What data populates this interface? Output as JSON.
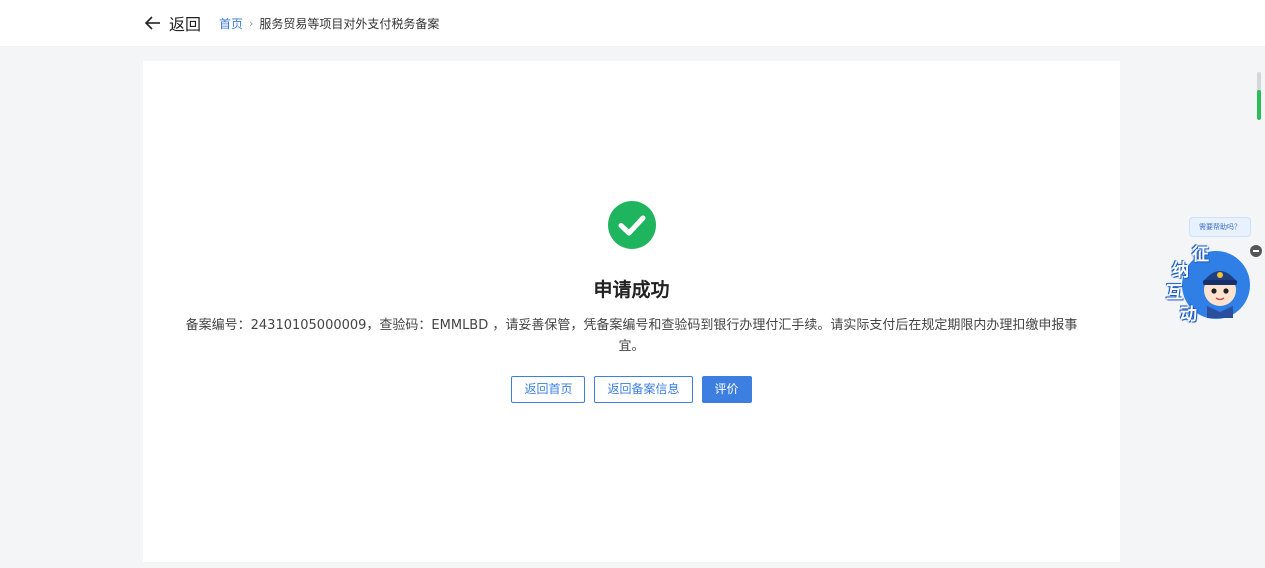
{
  "header": {
    "back_label": "返回",
    "breadcrumb": {
      "home": "首页",
      "separator": "›",
      "current": "服务贸易等项目对外支付税务备案"
    }
  },
  "result": {
    "icon": "check-circle-icon",
    "title": "申请成功",
    "message": "备案编号：24310105000009，查验码：EMMLBD ，请妥善保管，凭备案编号和查验码到银行办理付汇手续。请实际支付后在规定期限内办理扣缴申报事宜。"
  },
  "actions": {
    "home_label": "返回首页",
    "record_label": "返回备案信息",
    "rate_label": "评价"
  },
  "assistant": {
    "bubble": "需要帮助吗？",
    "chars": [
      "征",
      "纳",
      "互",
      "动"
    ]
  },
  "colors": {
    "accent": "#3d7fe0",
    "success": "#1fb45e",
    "scroll_thumb": "#2bbd57"
  }
}
